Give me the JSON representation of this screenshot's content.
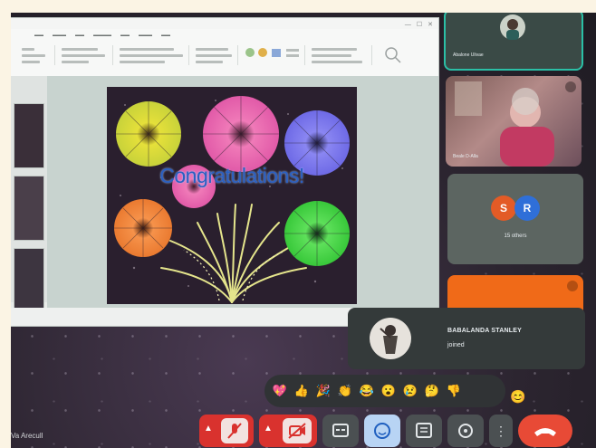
{
  "slide": {
    "caption": "Congratulations!"
  },
  "participants": {
    "tile1_name": "Abalone Ulivae",
    "tile2_name": "Beale D-Alla",
    "others_avatars": [
      "S",
      "R"
    ],
    "others_label": "15 others"
  },
  "toast": {
    "name": "BABALANDA STANLEY",
    "status": "joined"
  },
  "reactions": [
    "💖",
    "👍",
    "🎉",
    "👏",
    "😂",
    "😮",
    "😢",
    "🤔",
    "👎"
  ],
  "extra_reaction": "😊",
  "bottom_left_label": "Va Arecull",
  "colors": {
    "active_tile_border": "#2bbfa6",
    "mic_off_red": "#d9322e",
    "leave_red": "#e84a36",
    "tile_gray": "#5c6561",
    "tile_orange": "#f06a18",
    "avatar_s": "#e35b26",
    "avatar_r": "#2f6fd8"
  },
  "icons": [
    "mic-off-icon",
    "camera-off-icon",
    "captions-icon",
    "emoji-icon",
    "present-icon",
    "activities-icon",
    "more-icon",
    "leave-call-icon"
  ]
}
